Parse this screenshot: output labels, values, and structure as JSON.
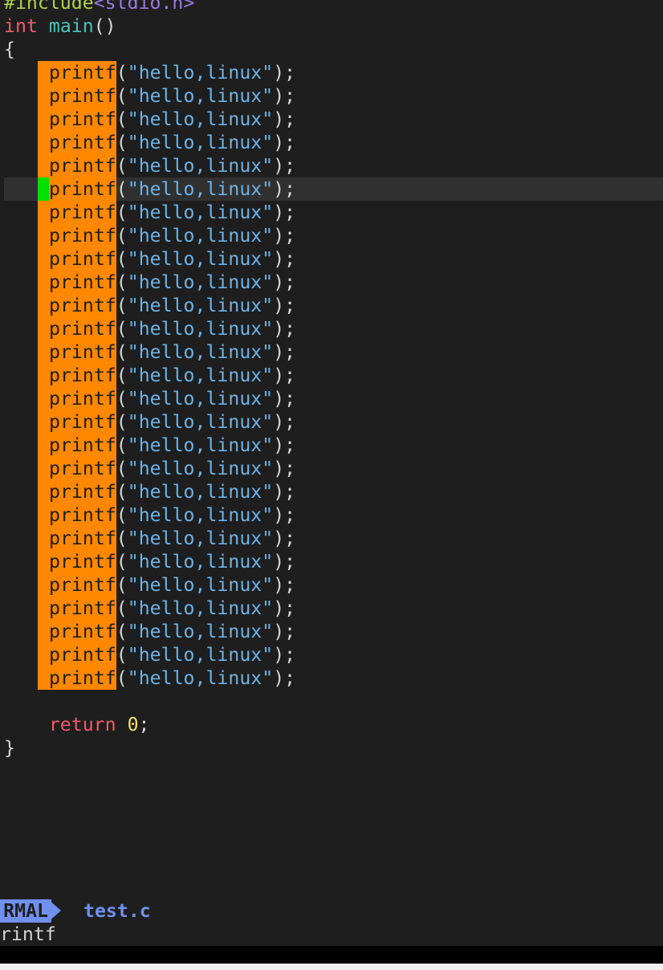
{
  "editor": {
    "include_directive": "#include",
    "include_header": "<stdio.h>",
    "main_type": "int",
    "main_name": "main",
    "main_parens": "()",
    "open_brace": "{",
    "close_brace": "}",
    "printf_fn": "printf",
    "printf_args_open": "(",
    "printf_string": "\"hello,linux\"",
    "printf_args_close": ");",
    "printf_line_count": 27,
    "cursor_line_index": 5,
    "return_keyword": "return",
    "return_value": "0",
    "return_semicolon": ";"
  },
  "statusline": {
    "mode": "NORMAL",
    "mode_visible": "RMAL",
    "filename": "test.c"
  },
  "cmdline": {
    "text": "printf",
    "visible_text": "rintf"
  },
  "colors": {
    "background": "#1e1e1e",
    "visual_block": "#ff8800",
    "cursor": "#00e000",
    "keyword": "#f05a6a",
    "function": "#4ec0b8",
    "string": "#6cb3e8",
    "number": "#f0e060",
    "mode_badge": "#7090f0"
  }
}
